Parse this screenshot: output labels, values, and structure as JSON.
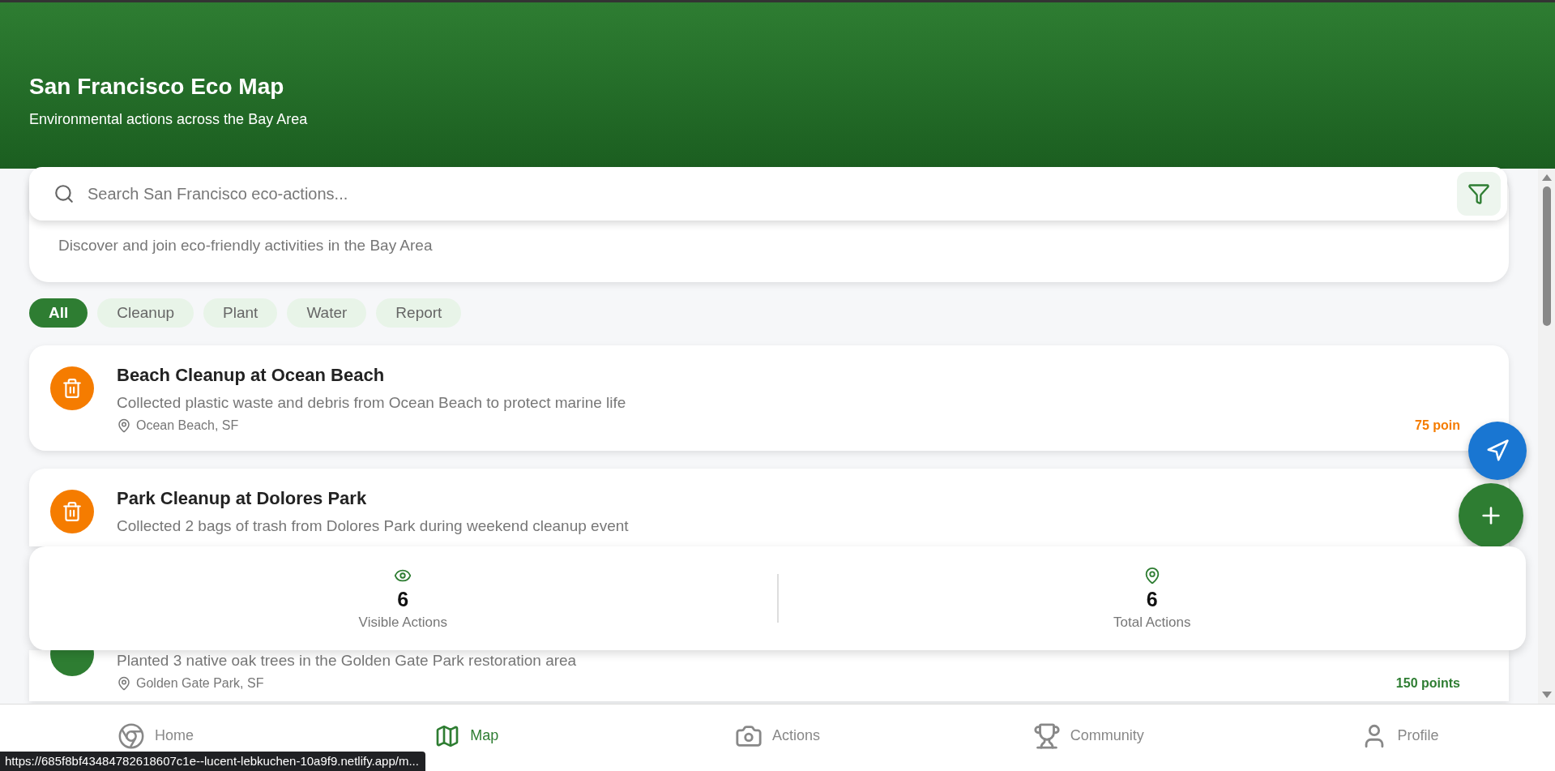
{
  "header": {
    "title": "San Francisco Eco Map",
    "subtitle": "Environmental actions across the Bay Area"
  },
  "search": {
    "placeholder": "Search San Francisco eco-actions..."
  },
  "intro": {
    "subtitle": "Discover and join eco-friendly activities in the Bay Area"
  },
  "filters": [
    {
      "label": "All",
      "selected": true
    },
    {
      "label": "Cleanup",
      "selected": false
    },
    {
      "label": "Plant",
      "selected": false
    },
    {
      "label": "Water",
      "selected": false
    },
    {
      "label": "Report",
      "selected": false
    }
  ],
  "actions": [
    {
      "kind": "cleanup",
      "title": "Beach Cleanup at Ocean Beach",
      "description": "Collected plastic waste and debris from Ocean Beach to protect marine life",
      "location": "Ocean Beach, SF",
      "points": "75 poin"
    },
    {
      "kind": "cleanup",
      "title": "Park Cleanup at Dolores Park",
      "description": "Collected 2 bags of trash from Dolores Park during weekend cleanup event"
    },
    {
      "kind": "plant",
      "description": "Planted 3 native oak trees in the Golden Gate Park restoration area",
      "location": "Golden Gate Park, SF",
      "points": "150 points"
    }
  ],
  "stats": [
    {
      "kind": "visible",
      "value": "6",
      "label": "Visible Actions"
    },
    {
      "kind": "total",
      "value": "6",
      "label": "Total Actions"
    }
  ],
  "nav": [
    {
      "kind": "home",
      "label": "Home",
      "selected": false
    },
    {
      "kind": "map",
      "label": "Map",
      "selected": true
    },
    {
      "kind": "actions",
      "label": "Actions",
      "selected": false
    },
    {
      "kind": "community",
      "label": "Community",
      "selected": false
    },
    {
      "kind": "profile",
      "label": "Profile",
      "selected": false
    }
  ],
  "status_bar": "https://685f8bf43484782618607c1e--lucent-lebkuchen-10a9f9.netlify.app/m..."
}
